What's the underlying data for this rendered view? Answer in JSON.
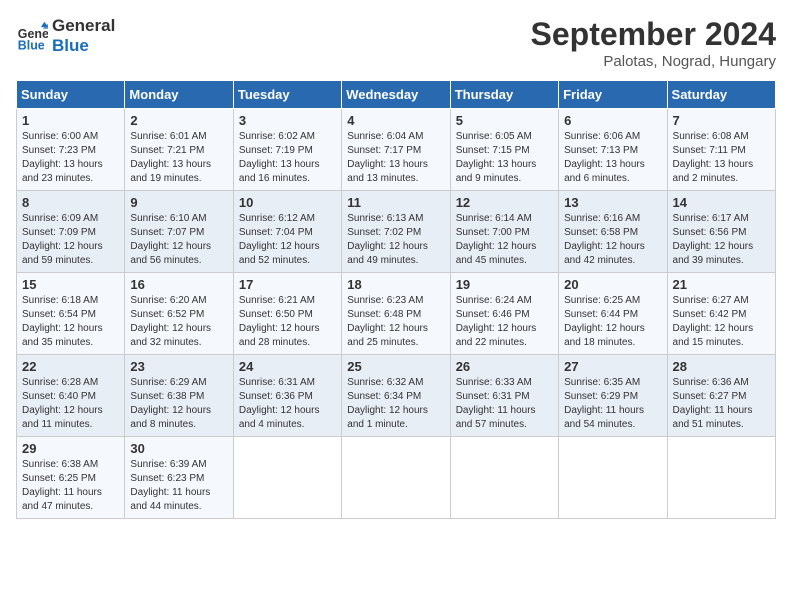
{
  "header": {
    "logo_line1": "General",
    "logo_line2": "Blue",
    "month": "September 2024",
    "location": "Palotas, Nograd, Hungary"
  },
  "weekdays": [
    "Sunday",
    "Monday",
    "Tuesday",
    "Wednesday",
    "Thursday",
    "Friday",
    "Saturday"
  ],
  "weeks": [
    [
      {
        "day": "1",
        "sunrise": "Sunrise: 6:00 AM",
        "sunset": "Sunset: 7:23 PM",
        "daylight": "Daylight: 13 hours and 23 minutes."
      },
      {
        "day": "2",
        "sunrise": "Sunrise: 6:01 AM",
        "sunset": "Sunset: 7:21 PM",
        "daylight": "Daylight: 13 hours and 19 minutes."
      },
      {
        "day": "3",
        "sunrise": "Sunrise: 6:02 AM",
        "sunset": "Sunset: 7:19 PM",
        "daylight": "Daylight: 13 hours and 16 minutes."
      },
      {
        "day": "4",
        "sunrise": "Sunrise: 6:04 AM",
        "sunset": "Sunset: 7:17 PM",
        "daylight": "Daylight: 13 hours and 13 minutes."
      },
      {
        "day": "5",
        "sunrise": "Sunrise: 6:05 AM",
        "sunset": "Sunset: 7:15 PM",
        "daylight": "Daylight: 13 hours and 9 minutes."
      },
      {
        "day": "6",
        "sunrise": "Sunrise: 6:06 AM",
        "sunset": "Sunset: 7:13 PM",
        "daylight": "Daylight: 13 hours and 6 minutes."
      },
      {
        "day": "7",
        "sunrise": "Sunrise: 6:08 AM",
        "sunset": "Sunset: 7:11 PM",
        "daylight": "Daylight: 13 hours and 2 minutes."
      }
    ],
    [
      {
        "day": "8",
        "sunrise": "Sunrise: 6:09 AM",
        "sunset": "Sunset: 7:09 PM",
        "daylight": "Daylight: 12 hours and 59 minutes."
      },
      {
        "day": "9",
        "sunrise": "Sunrise: 6:10 AM",
        "sunset": "Sunset: 7:07 PM",
        "daylight": "Daylight: 12 hours and 56 minutes."
      },
      {
        "day": "10",
        "sunrise": "Sunrise: 6:12 AM",
        "sunset": "Sunset: 7:04 PM",
        "daylight": "Daylight: 12 hours and 52 minutes."
      },
      {
        "day": "11",
        "sunrise": "Sunrise: 6:13 AM",
        "sunset": "Sunset: 7:02 PM",
        "daylight": "Daylight: 12 hours and 49 minutes."
      },
      {
        "day": "12",
        "sunrise": "Sunrise: 6:14 AM",
        "sunset": "Sunset: 7:00 PM",
        "daylight": "Daylight: 12 hours and 45 minutes."
      },
      {
        "day": "13",
        "sunrise": "Sunrise: 6:16 AM",
        "sunset": "Sunset: 6:58 PM",
        "daylight": "Daylight: 12 hours and 42 minutes."
      },
      {
        "day": "14",
        "sunrise": "Sunrise: 6:17 AM",
        "sunset": "Sunset: 6:56 PM",
        "daylight": "Daylight: 12 hours and 39 minutes."
      }
    ],
    [
      {
        "day": "15",
        "sunrise": "Sunrise: 6:18 AM",
        "sunset": "Sunset: 6:54 PM",
        "daylight": "Daylight: 12 hours and 35 minutes."
      },
      {
        "day": "16",
        "sunrise": "Sunrise: 6:20 AM",
        "sunset": "Sunset: 6:52 PM",
        "daylight": "Daylight: 12 hours and 32 minutes."
      },
      {
        "day": "17",
        "sunrise": "Sunrise: 6:21 AM",
        "sunset": "Sunset: 6:50 PM",
        "daylight": "Daylight: 12 hours and 28 minutes."
      },
      {
        "day": "18",
        "sunrise": "Sunrise: 6:23 AM",
        "sunset": "Sunset: 6:48 PM",
        "daylight": "Daylight: 12 hours and 25 minutes."
      },
      {
        "day": "19",
        "sunrise": "Sunrise: 6:24 AM",
        "sunset": "Sunset: 6:46 PM",
        "daylight": "Daylight: 12 hours and 22 minutes."
      },
      {
        "day": "20",
        "sunrise": "Sunrise: 6:25 AM",
        "sunset": "Sunset: 6:44 PM",
        "daylight": "Daylight: 12 hours and 18 minutes."
      },
      {
        "day": "21",
        "sunrise": "Sunrise: 6:27 AM",
        "sunset": "Sunset: 6:42 PM",
        "daylight": "Daylight: 12 hours and 15 minutes."
      }
    ],
    [
      {
        "day": "22",
        "sunrise": "Sunrise: 6:28 AM",
        "sunset": "Sunset: 6:40 PM",
        "daylight": "Daylight: 12 hours and 11 minutes."
      },
      {
        "day": "23",
        "sunrise": "Sunrise: 6:29 AM",
        "sunset": "Sunset: 6:38 PM",
        "daylight": "Daylight: 12 hours and 8 minutes."
      },
      {
        "day": "24",
        "sunrise": "Sunrise: 6:31 AM",
        "sunset": "Sunset: 6:36 PM",
        "daylight": "Daylight: 12 hours and 4 minutes."
      },
      {
        "day": "25",
        "sunrise": "Sunrise: 6:32 AM",
        "sunset": "Sunset: 6:34 PM",
        "daylight": "Daylight: 12 hours and 1 minute."
      },
      {
        "day": "26",
        "sunrise": "Sunrise: 6:33 AM",
        "sunset": "Sunset: 6:31 PM",
        "daylight": "Daylight: 11 hours and 57 minutes."
      },
      {
        "day": "27",
        "sunrise": "Sunrise: 6:35 AM",
        "sunset": "Sunset: 6:29 PM",
        "daylight": "Daylight: 11 hours and 54 minutes."
      },
      {
        "day": "28",
        "sunrise": "Sunrise: 6:36 AM",
        "sunset": "Sunset: 6:27 PM",
        "daylight": "Daylight: 11 hours and 51 minutes."
      }
    ],
    [
      {
        "day": "29",
        "sunrise": "Sunrise: 6:38 AM",
        "sunset": "Sunset: 6:25 PM",
        "daylight": "Daylight: 11 hours and 47 minutes."
      },
      {
        "day": "30",
        "sunrise": "Sunrise: 6:39 AM",
        "sunset": "Sunset: 6:23 PM",
        "daylight": "Daylight: 11 hours and 44 minutes."
      },
      null,
      null,
      null,
      null,
      null
    ]
  ]
}
